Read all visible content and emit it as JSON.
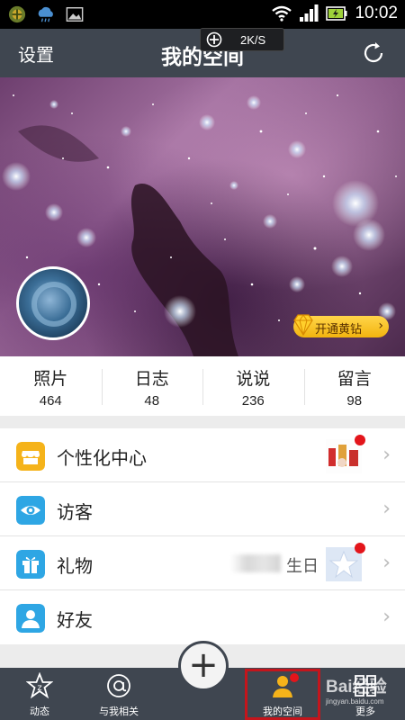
{
  "statusbar": {
    "time": "10:02",
    "speed": "2K/S"
  },
  "header": {
    "settings_label": "设置",
    "title": "我的空间"
  },
  "cover": {
    "vip_label": "开通黄钻"
  },
  "stats": [
    {
      "label": "照片",
      "count": "464"
    },
    {
      "label": "日志",
      "count": "48"
    },
    {
      "label": "说说",
      "count": "236"
    },
    {
      "label": "留言",
      "count": "98"
    }
  ],
  "menu": [
    {
      "label": "个性化中心",
      "icon": "shop-icon",
      "color": "#f5b31a"
    },
    {
      "label": "访客",
      "icon": "eye-icon",
      "color": "#2ea6e4"
    },
    {
      "label": "礼物",
      "icon": "gift-icon",
      "color": "#2ea6e4",
      "extra": "生日"
    },
    {
      "label": "好友",
      "icon": "person-icon",
      "color": "#2ea6e4"
    }
  ],
  "bottomnav": [
    {
      "label": "动态",
      "icon": "star-feed-icon"
    },
    {
      "label": "与我相关",
      "icon": "at-icon"
    },
    {
      "label": "我的空间",
      "icon": "user-icon"
    },
    {
      "label": "更多",
      "icon": "more-icon"
    }
  ],
  "watermark": {
    "line1": "Bai经验",
    "line2": "jingyan.baidu.com"
  },
  "colors": {
    "bar_bg": "#3f4650",
    "vip_gold": "#f3b40e",
    "badge_red": "#e3151b",
    "accent_blue": "#2ea6e4",
    "accent_yellow": "#f5b31a"
  }
}
